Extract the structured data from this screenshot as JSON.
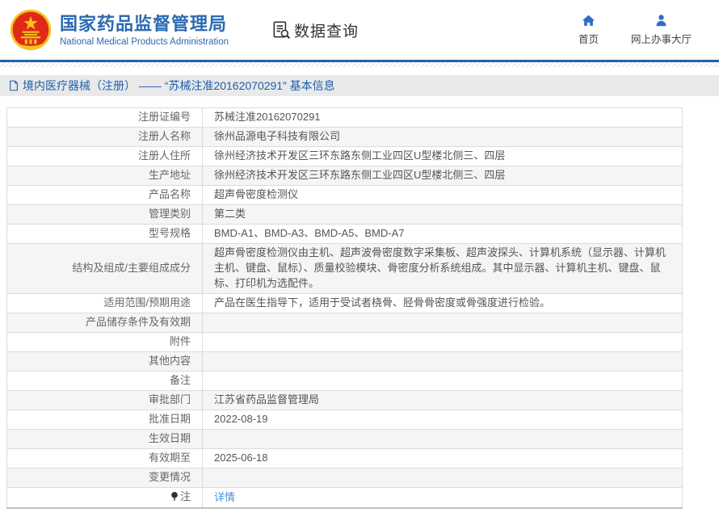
{
  "header": {
    "title": "国家药品监督管理局",
    "subtitle": "National Medical Products Administration",
    "section_label": "数据查询",
    "nav": [
      {
        "label": "首页"
      },
      {
        "label": "网上办事大厅"
      }
    ]
  },
  "breadcrumb": {
    "text": "境内医疗器械（注册） —— “苏械注准20162070291” 基本信息"
  },
  "table": {
    "rows": [
      {
        "label": "注册证编号",
        "value": "苏械注准20162070291"
      },
      {
        "label": "注册人名称",
        "value": "徐州品源电子科技有限公司"
      },
      {
        "label": "注册人住所",
        "value": "徐州经济技术开发区三环东路东侧工业四区U型楼北侧三、四层"
      },
      {
        "label": "生产地址",
        "value": "徐州经济技术开发区三环东路东侧工业四区U型楼北侧三、四层"
      },
      {
        "label": "产品名称",
        "value": "超声骨密度检测仪"
      },
      {
        "label": "管理类别",
        "value": "第二类"
      },
      {
        "label": "型号规格",
        "value": "BMD-A1、BMD-A3、BMD-A5、BMD-A7"
      },
      {
        "label": "结构及组成/主要组成成分",
        "value": "超声骨密度检测仪由主机、超声波骨密度数字采集板、超声波探头、计算机系统（显示器、计算机主机、键盘、鼠标）、质量校验模块、骨密度分析系统组成。其中显示器、计算机主机、键盘、鼠标、打印机为选配件。"
      },
      {
        "label": "适用范围/预期用途",
        "value": "产品在医生指导下，适用于受试者桡骨、胫骨骨密度或骨强度进行检验。"
      },
      {
        "label": "产品储存条件及有效期",
        "value": ""
      },
      {
        "label": "附件",
        "value": ""
      },
      {
        "label": "其他内容",
        "value": ""
      },
      {
        "label": "备注",
        "value": ""
      },
      {
        "label": "审批部门",
        "value": "江苏省药品监督管理局"
      },
      {
        "label": "批准日期",
        "value": "2022-08-19"
      },
      {
        "label": "生效日期",
        "value": ""
      },
      {
        "label": "有效期至",
        "value": "2025-06-18"
      },
      {
        "label": "变更情况",
        "value": ""
      },
      {
        "label": "注",
        "value": "详情"
      }
    ]
  },
  "colors": {
    "brand_blue": "#2a6ab0",
    "line_blue": "#1c64a8",
    "breadcrumb_text": "#1d5fae",
    "breadcrumb_bg": "#e9e9e9",
    "link_blue": "#4a90e2",
    "row_alt_bg": "#f5f5f5",
    "emblem_red": "#e02a16",
    "emblem_gold": "#f5c31d"
  }
}
